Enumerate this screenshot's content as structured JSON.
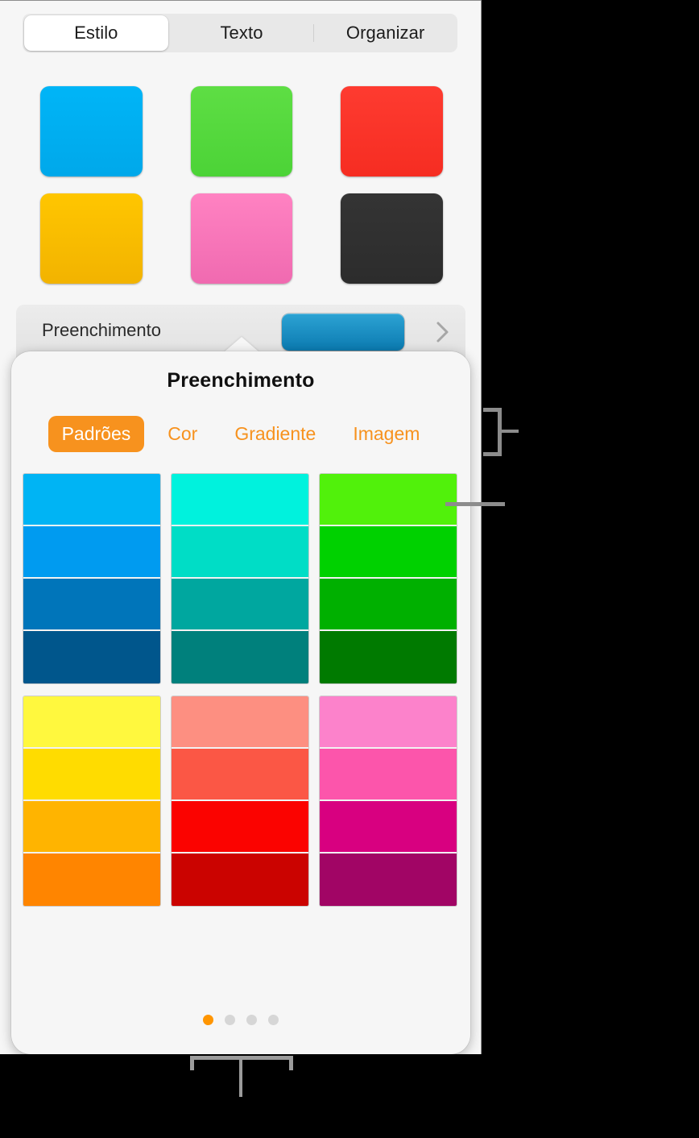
{
  "panel": {
    "segmented_tabs": [
      {
        "label": "Estilo",
        "selected": true
      },
      {
        "label": "Texto",
        "selected": false
      },
      {
        "label": "Organizar",
        "selected": false
      }
    ],
    "style_swatches": [
      [
        {
          "name": "blue",
          "top": "#00b5f7",
          "bottom": "#00a8ea"
        },
        {
          "name": "green",
          "top": "#5ede44",
          "bottom": "#4cd337"
        },
        {
          "name": "red",
          "top": "#fe3b30",
          "bottom": "#f62d22"
        }
      ],
      [
        {
          "name": "yellow",
          "top": "#ffc600",
          "bottom": "#f2b300"
        },
        {
          "name": "pink",
          "top": "#ff82c2",
          "bottom": "#f06ab0"
        },
        {
          "name": "black",
          "top": "#343434",
          "bottom": "#2c2c2c"
        }
      ]
    ],
    "fill_row": {
      "label": "Preenchimento",
      "swatch_color_top": "#2ca3d4",
      "swatch_color_bottom": "#0b7ab0",
      "disclosure_icon": "chevron-right-icon"
    }
  },
  "popover": {
    "title": "Preenchimento",
    "tabs": [
      {
        "label": "Padrões",
        "selected": true
      },
      {
        "label": "Cor",
        "selected": false
      },
      {
        "label": "Gradiente",
        "selected": false
      },
      {
        "label": "Imagem",
        "selected": false
      }
    ],
    "accent_color": "#f7921e",
    "swatch_groups": [
      [
        {
          "name": "blue-ramp",
          "colors": [
            "#00b4f4",
            "#009bf0",
            "#0075ba",
            "#00568c"
          ]
        },
        {
          "name": "cyan-ramp",
          "colors": [
            "#00f2dd",
            "#00ddc6",
            "#00a79f",
            "#00807c"
          ]
        },
        {
          "name": "green-ramp",
          "colors": [
            "#51f10b",
            "#00d100",
            "#00b000",
            "#007a00"
          ]
        }
      ],
      [
        {
          "name": "yellow-ramp",
          "colors": [
            "#fff83e",
            "#ffdc00",
            "#ffb400",
            "#ff8500"
          ]
        },
        {
          "name": "coral-ramp",
          "colors": [
            "#fd8f81",
            "#fb5745",
            "#fb0300",
            "#cb0300"
          ]
        },
        {
          "name": "pink-ramp",
          "colors": [
            "#fc82cb",
            "#fc55ab",
            "#d80080",
            "#a10565"
          ]
        }
      ]
    ],
    "page_dots": {
      "count": 4,
      "active_index": 0
    }
  },
  "annotations": [
    {
      "name": "callout-tabs-bracket",
      "target": "popover-tabs"
    },
    {
      "name": "callout-swatch-line",
      "target": "green-ramp-swatch"
    },
    {
      "name": "callout-bottom-bracket",
      "target": "popover-page-dots"
    }
  ]
}
